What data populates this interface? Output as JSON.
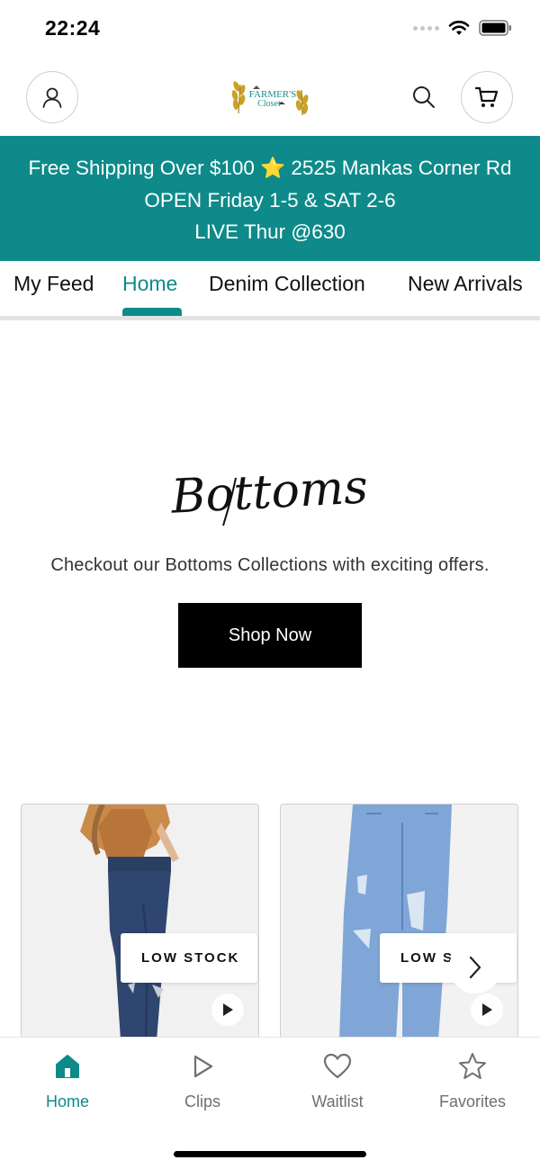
{
  "status_bar": {
    "time": "22:24"
  },
  "header": {
    "logo_text": "FARMER'S Closet"
  },
  "promo": {
    "line1": "Free Shipping Over $100 ⭐ 2525 Mankas Corner Rd",
    "line2": "OPEN Friday 1-5 & SAT 2-6",
    "line3": "LIVE Thur @630"
  },
  "tabs": [
    "My Feed",
    "Home",
    "Denim Collection",
    "New Arrivals"
  ],
  "active_tab": "Home",
  "hero": {
    "script_title": "Bottoms",
    "subtitle": "Checkout our Bottoms Collections with exciting offers.",
    "button_label": "Shop Now"
  },
  "products": [
    {
      "badge": "LOW STOCK"
    },
    {
      "badge": "LOW STOCK"
    }
  ],
  "bottom_nav": [
    {
      "label": "Home",
      "icon": "home-icon"
    },
    {
      "label": "Clips",
      "icon": "play-icon"
    },
    {
      "label": "Waitlist",
      "icon": "heart-icon"
    },
    {
      "label": "Favorites",
      "icon": "star-icon"
    }
  ],
  "active_nav": "Home",
  "colors": {
    "accent": "#0e8a8a",
    "banner": "#0e8a8a",
    "button": "#000000"
  }
}
